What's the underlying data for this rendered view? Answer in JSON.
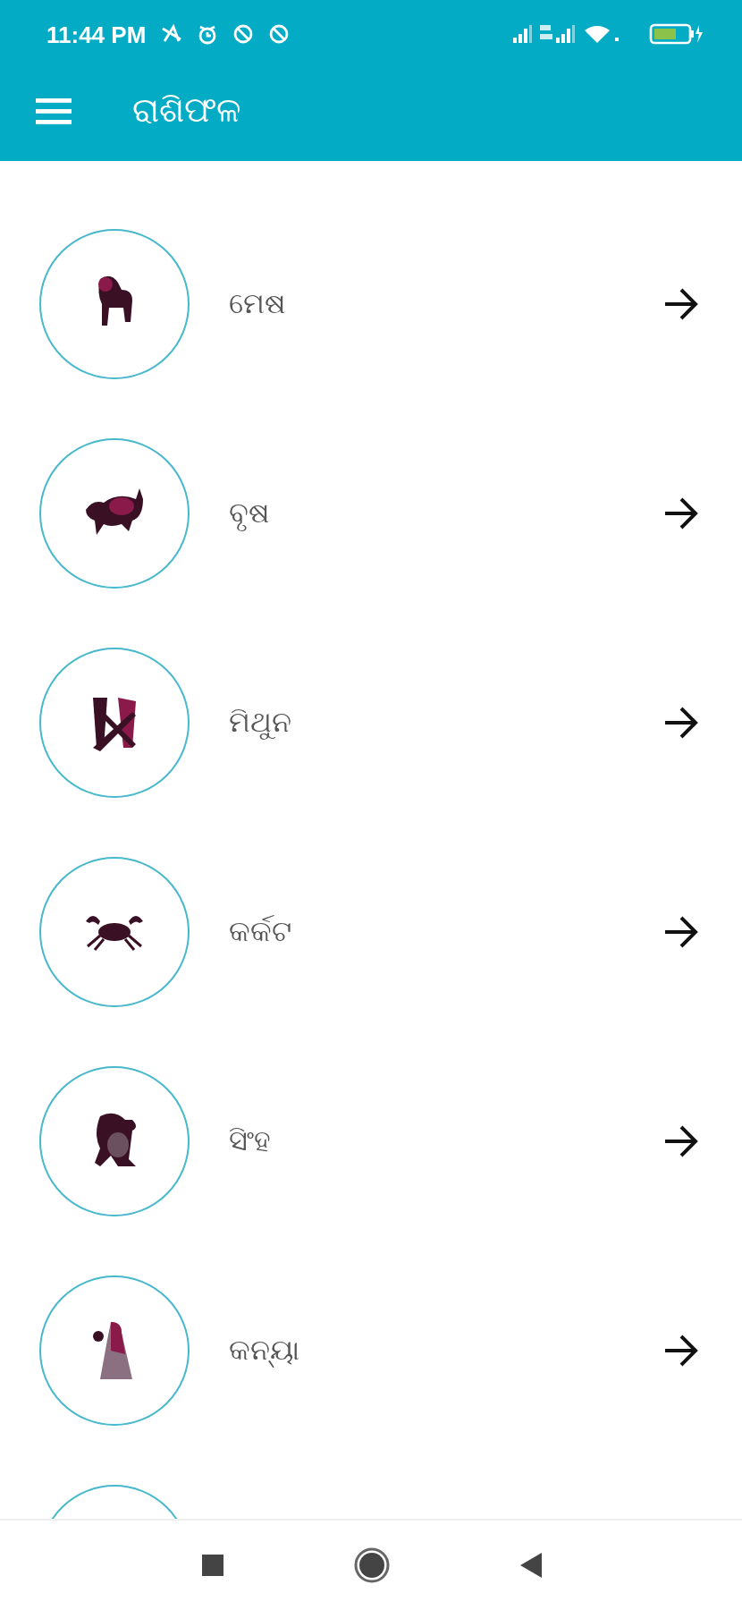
{
  "status_bar": {
    "time": "11:44 PM"
  },
  "app_bar": {
    "title": "ରାଶିଫଳ"
  },
  "signs": [
    {
      "label": "ମେଷ"
    },
    {
      "label": "ବୃଷ"
    },
    {
      "label": "ମିଥୁନ"
    },
    {
      "label": "କର୍କଟ"
    },
    {
      "label": "ସିଂହ"
    },
    {
      "label": "କନ୍ୟା"
    },
    {
      "partial": true
    }
  ]
}
